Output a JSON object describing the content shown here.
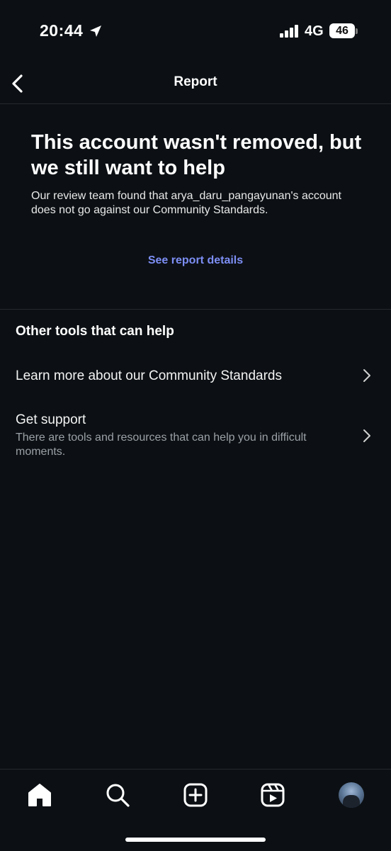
{
  "status_bar": {
    "time": "20:44",
    "network": "4G",
    "battery": "46"
  },
  "header": {
    "title": "Report",
    "back_icon": "chevron-left-icon"
  },
  "result": {
    "headline": "This account wasn't removed, but we still want to help",
    "description": "Our review team found that arya_daru_pangayunan's account does not go against our Community Standards.",
    "details_link": "See report details"
  },
  "tools": {
    "heading": "Other tools that can help",
    "items": [
      {
        "title": "Learn more about our Community Standards",
        "subtitle": ""
      },
      {
        "title": "Get support",
        "subtitle": "There are tools and resources that can help you in difficult moments."
      }
    ]
  },
  "tab_bar": {
    "items": [
      "home-icon",
      "search-icon",
      "create-post-icon",
      "reels-icon",
      "profile-avatar"
    ]
  },
  "colors": {
    "background": "#0c1014",
    "link": "#7d8ef5",
    "secondary_text": "#9aa0a6",
    "divider": "#262a2e"
  }
}
